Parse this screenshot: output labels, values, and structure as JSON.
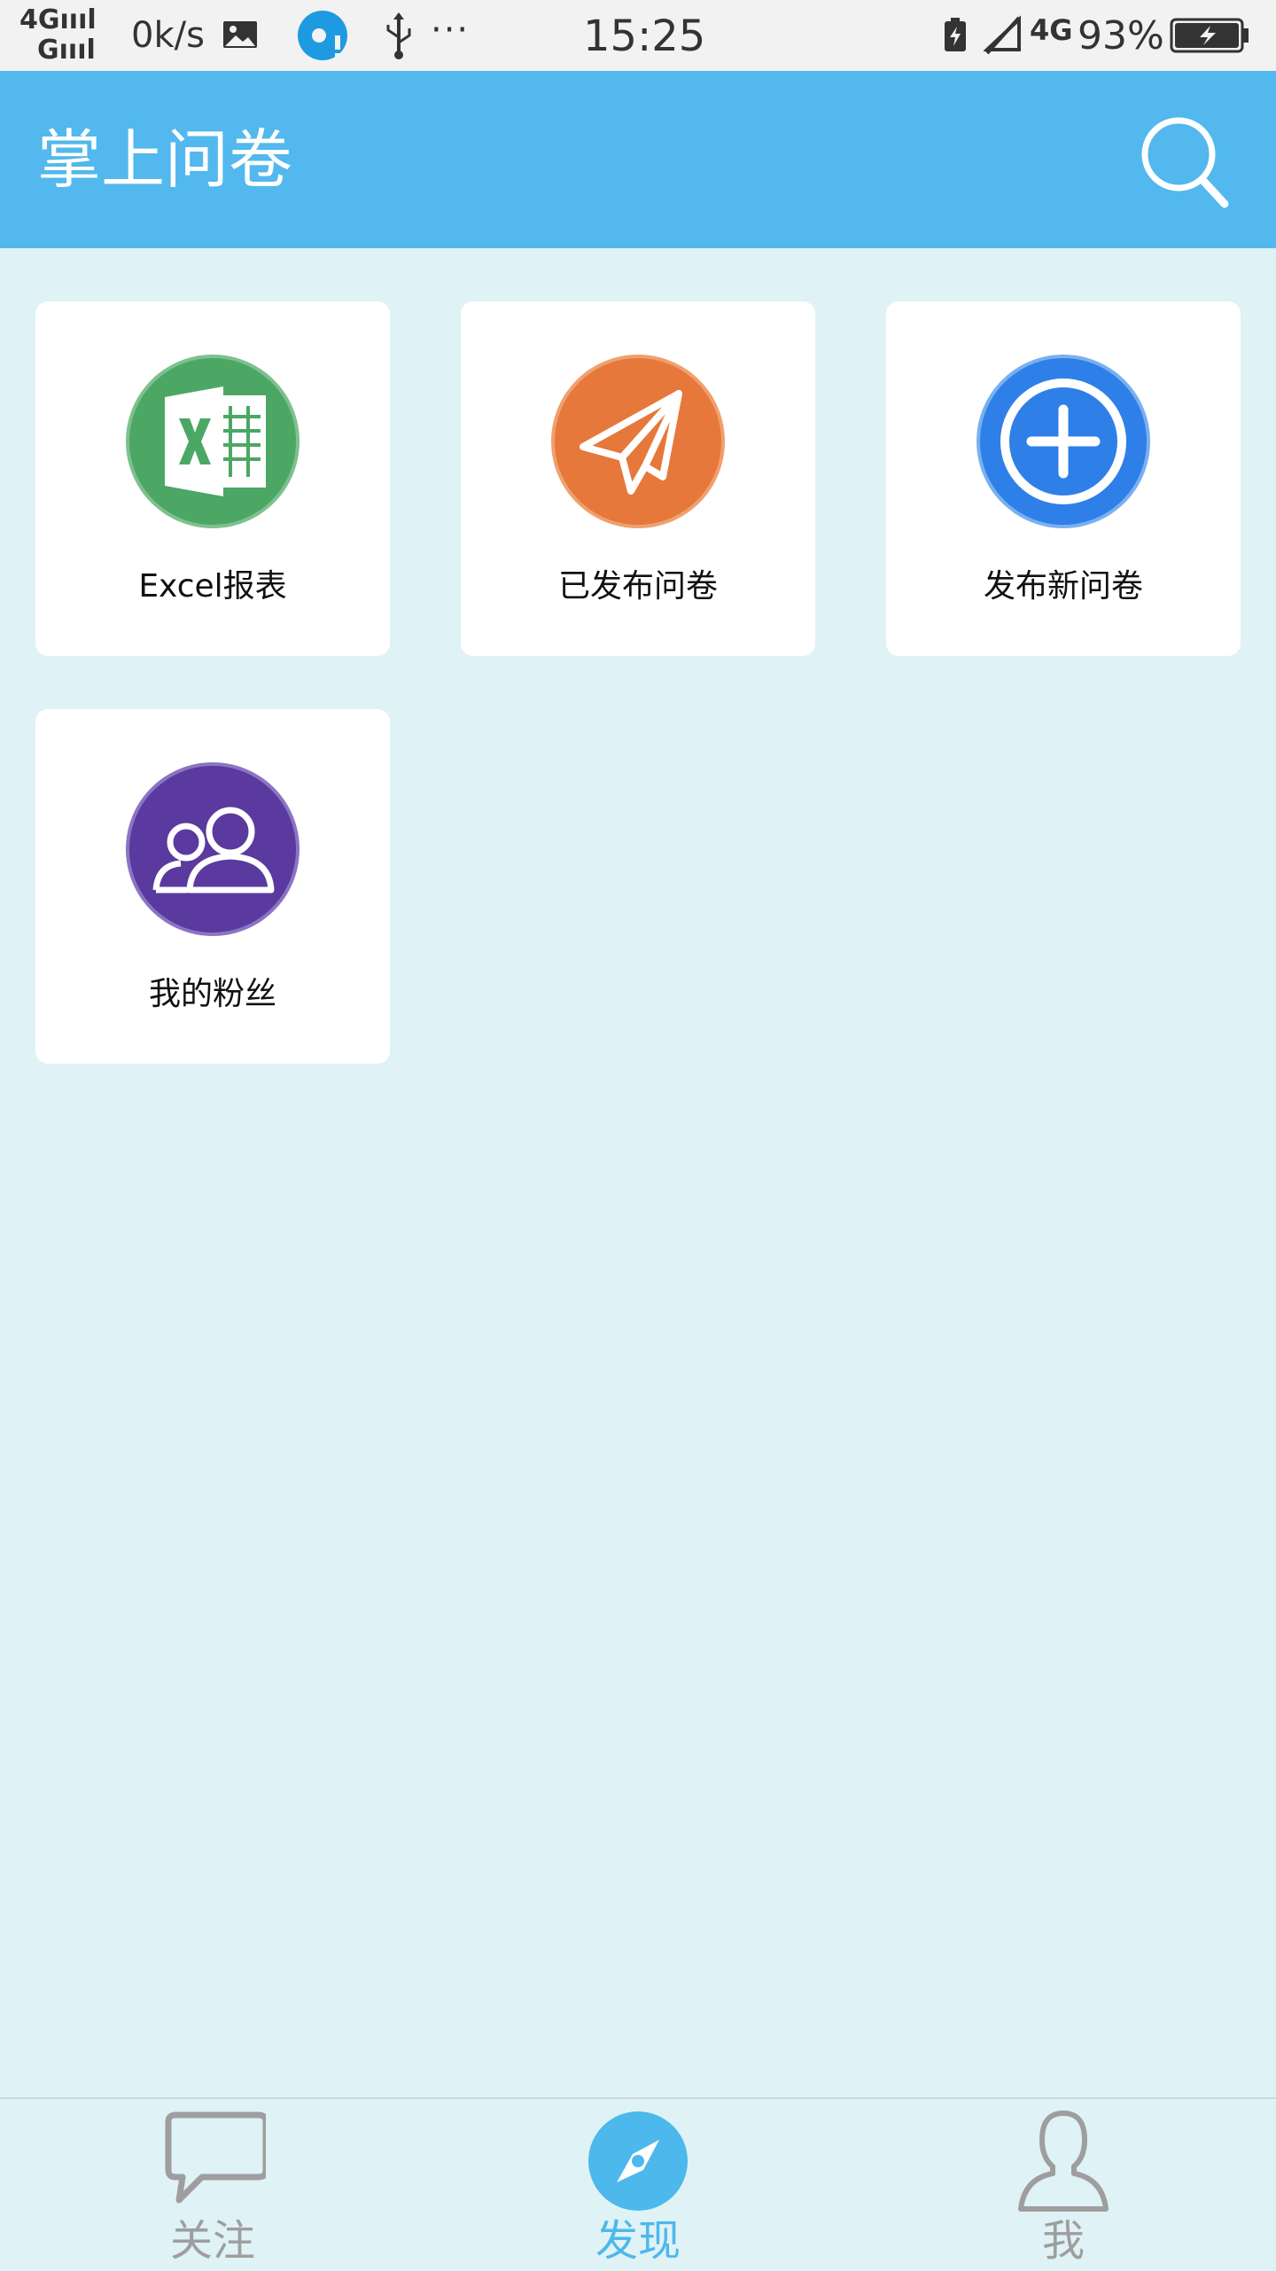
{
  "status_bar": {
    "signal_top": "4G",
    "signal_bottom": "G",
    "speed": "0k/s",
    "more": "···",
    "time": "15:25",
    "network": "4G",
    "battery_percent": "93%",
    "icons": [
      "gallery-icon",
      "app-notification-icon",
      "usb-icon",
      "battery-saver-icon",
      "mute-icon",
      "battery-icon"
    ]
  },
  "app_bar": {
    "title": "掌上问卷",
    "search_icon": "search-icon",
    "background_color": "#52b8ed"
  },
  "grid": {
    "items": [
      {
        "label": "Excel报表",
        "icon": "excel-icon",
        "color": "#4ca765"
      },
      {
        "label": "已发布问卷",
        "icon": "paper-plane-icon",
        "color": "#e6783c"
      },
      {
        "label": "发布新问卷",
        "icon": "add-circle-icon",
        "color": "#2f7fe8"
      },
      {
        "label": "我的粉丝",
        "icon": "fans-icon",
        "color": "#5a3a9e"
      }
    ]
  },
  "bottom_nav": {
    "items": [
      {
        "label": "关注",
        "icon": "chat-bubble-icon",
        "active": false
      },
      {
        "label": "发现",
        "icon": "compass-icon",
        "active": true
      },
      {
        "label": "我",
        "icon": "person-icon",
        "active": false
      }
    ],
    "active_color": "#4db8ec",
    "inactive_color": "#9e9e9e"
  }
}
